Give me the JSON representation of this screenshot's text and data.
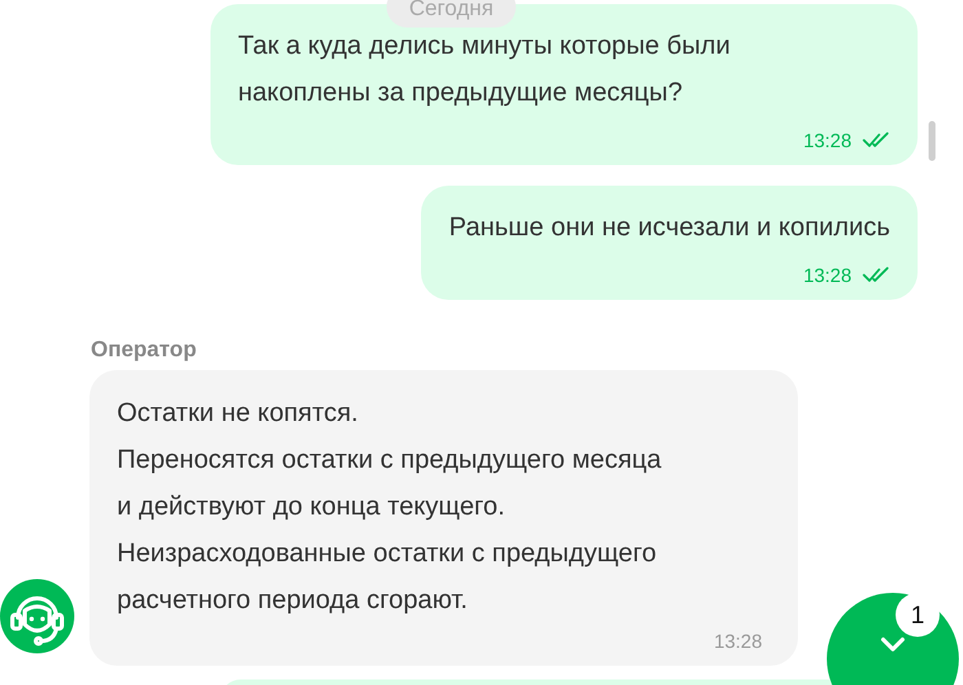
{
  "date_label": "Сегодня",
  "messages": [
    {
      "kind": "outgoing",
      "text": "Так а куда делись минуты которые были\nнакоплены за предыдущие месяцы?",
      "time": "13:28",
      "read": true
    },
    {
      "kind": "outgoing",
      "text": "Раньше они не исчезали и копились",
      "time": "13:28",
      "read": true
    },
    {
      "kind": "incoming",
      "sender": "Оператор",
      "text": "Остатки не копятся.\nПереносятся остатки с предыдущего месяца\nи действуют до конца текущего.\nНеизрасходованные остатки с предыдущего\nрасчетного периода сгорают.",
      "time": "13:28"
    }
  ],
  "scroll_button": {
    "badge": "1"
  }
}
